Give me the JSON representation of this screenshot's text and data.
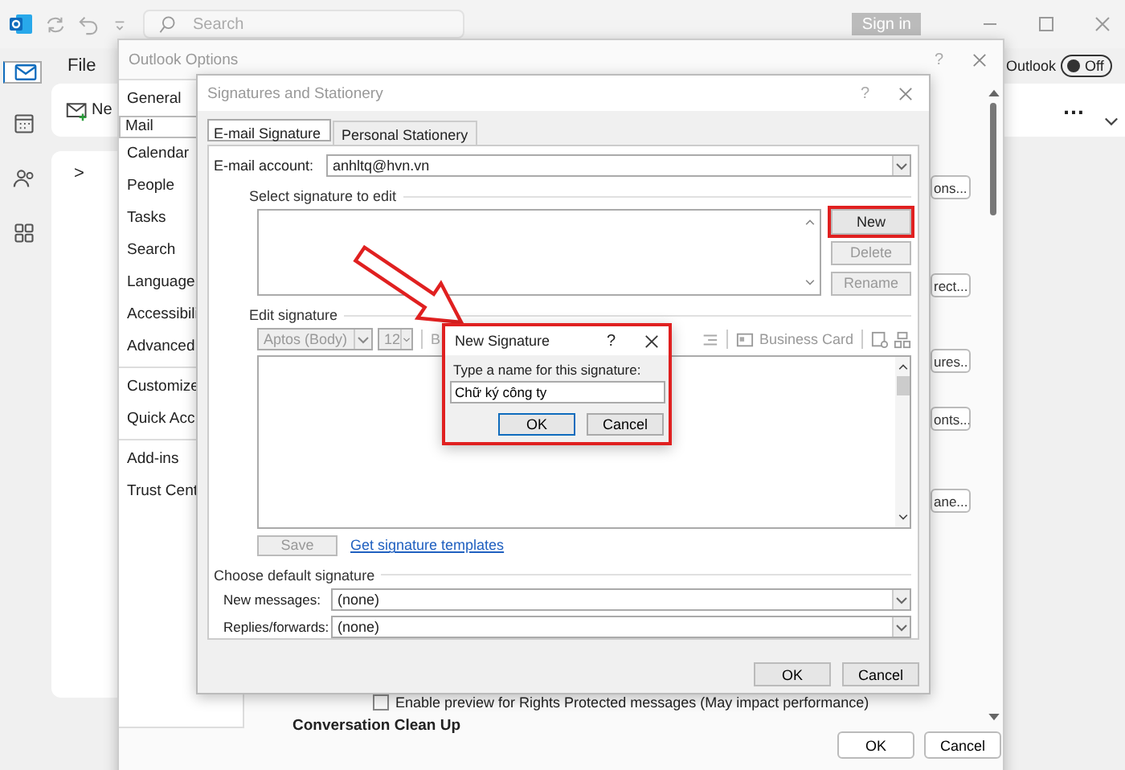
{
  "app": {
    "search_placeholder": "Search",
    "sign_in": "Sign in",
    "menu": "File",
    "outlook_label": "Outlook",
    "toggle": {
      "label": "Off",
      "on": false
    },
    "new_label": "Ne",
    "more": "…",
    "expand": ">"
  },
  "rail": [
    {
      "kind": "mail",
      "selected": true
    },
    {
      "kind": "calendar",
      "selected": false
    },
    {
      "kind": "people",
      "selected": false
    },
    {
      "kind": "apps",
      "selected": false
    }
  ],
  "options": {
    "title": "Outlook Options",
    "help": "?",
    "nav_groups": [
      [
        {
          "label": "General",
          "selected": false
        },
        {
          "label": "Mail",
          "selected": true
        },
        {
          "label": "Calendar",
          "selected": false
        },
        {
          "label": "People",
          "selected": false
        },
        {
          "label": "Tasks",
          "selected": false
        },
        {
          "label": "Search",
          "selected": false
        },
        {
          "label": "Language",
          "selected": false
        },
        {
          "label": "Accessibili",
          "selected": false
        },
        {
          "label": "Advanced",
          "selected": false
        }
      ],
      [
        {
          "label": "Customize",
          "selected": false
        },
        {
          "label": "Quick Acc",
          "selected": false
        }
      ],
      [
        {
          "label": "Add-ins",
          "selected": false
        },
        {
          "label": "Trust Cent",
          "selected": false
        }
      ]
    ],
    "side_buttons": [
      "ons...",
      "rect...",
      "ures...",
      "onts...",
      "ane..."
    ],
    "checkbox": {
      "label": "Enable preview for Rights Protected messages (May impact performance)",
      "checked": false
    },
    "section": "Conversation Clean Up",
    "ok": "OK",
    "cancel": "Cancel"
  },
  "sig": {
    "title": "Signatures and Stationery",
    "help": "?",
    "tabs": [
      {
        "label": "E-mail Signature",
        "selected": true
      },
      {
        "label": "Personal Stationery",
        "selected": false
      }
    ],
    "account_label": "E-mail account:",
    "account": "anhltq@hvn.vn",
    "select_label": "Select signature to edit",
    "buttons": [
      {
        "label": "New",
        "disabled": false,
        "highlighted": true
      },
      {
        "label": "Delete",
        "disabled": true,
        "highlighted": false
      },
      {
        "label": "Rename",
        "disabled": true,
        "highlighted": false
      }
    ],
    "edit_label": "Edit signature",
    "font": "Aptos (Body)",
    "size": "12",
    "bold": "B",
    "business_card": "Business Card",
    "save": {
      "label": "Save",
      "disabled": true
    },
    "templates_link": "Get signature templates",
    "default_label": "Choose default signature",
    "defaults": [
      {
        "label": "New messages:",
        "value": "(none)"
      },
      {
        "label": "Replies/forwards:",
        "value": "(none)"
      }
    ],
    "ok": "OK",
    "cancel": "Cancel"
  },
  "new_sig": {
    "title": "New Signature",
    "help": "?",
    "prompt": "Type a name for this signature:",
    "value": "Chữ ký công ty",
    "ok": "OK",
    "cancel": "Cancel",
    "highlighted": true
  }
}
